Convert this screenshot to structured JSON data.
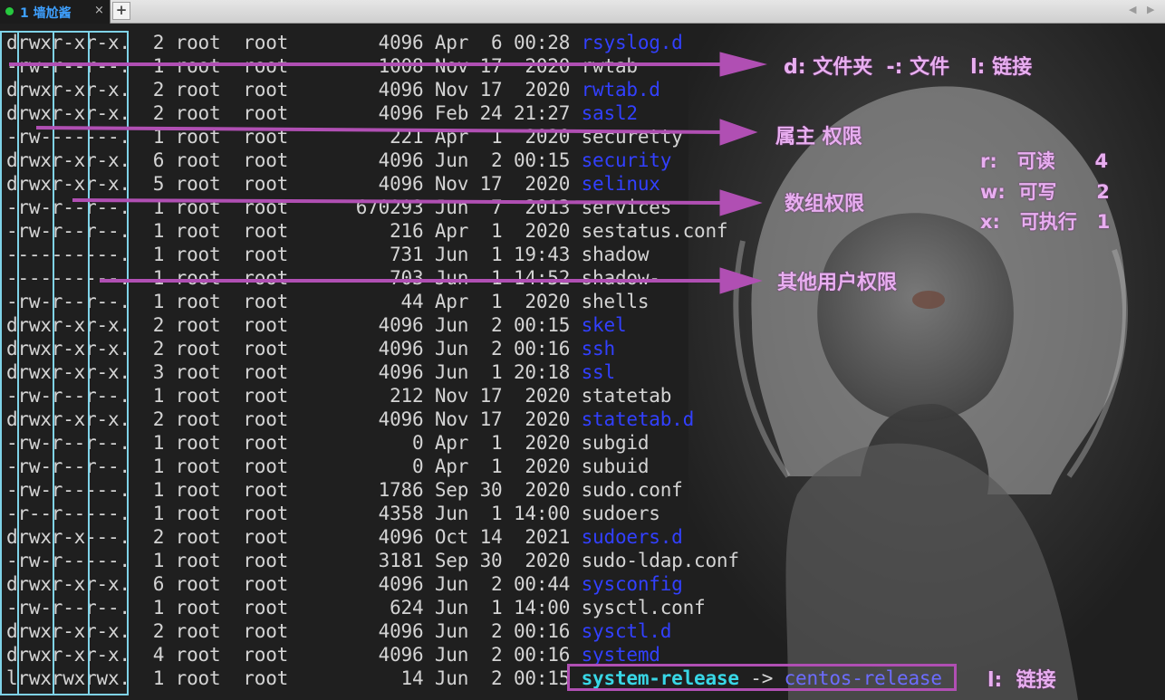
{
  "tabbar": {
    "tab_label": "1 墙尬酱",
    "close_glyph": "×",
    "add_glyph": "+",
    "nav_prev": "◀",
    "nav_next": "▶"
  },
  "listing": [
    {
      "perm": "drwxr-xr-x.",
      "links": "2",
      "owner": "root",
      "group": "root",
      "size": "4096",
      "month": "Apr",
      "day": "6",
      "time": "00:28",
      "name": "rsyslog.d",
      "kind": "dir"
    },
    {
      "perm": "-rw-r--r--.",
      "links": "1",
      "owner": "root",
      "group": "root",
      "size": "1008",
      "month": "Nov",
      "day": "17",
      "time": "2020",
      "name": "rwtab",
      "kind": "file"
    },
    {
      "perm": "drwxr-xr-x.",
      "links": "2",
      "owner": "root",
      "group": "root",
      "size": "4096",
      "month": "Nov",
      "day": "17",
      "time": "2020",
      "name": "rwtab.d",
      "kind": "dir"
    },
    {
      "perm": "drwxr-xr-x.",
      "links": "2",
      "owner": "root",
      "group": "root",
      "size": "4096",
      "month": "Feb",
      "day": "24",
      "time": "21:27",
      "name": "sasl2",
      "kind": "dir"
    },
    {
      "perm": "-rw-------.",
      "links": "1",
      "owner": "root",
      "group": "root",
      "size": "221",
      "month": "Apr",
      "day": "1",
      "time": "2020",
      "name": "securetty",
      "kind": "file"
    },
    {
      "perm": "drwxr-xr-x.",
      "links": "6",
      "owner": "root",
      "group": "root",
      "size": "4096",
      "month": "Jun",
      "day": "2",
      "time": "00:15",
      "name": "security",
      "kind": "dir"
    },
    {
      "perm": "drwxr-xr-x.",
      "links": "5",
      "owner": "root",
      "group": "root",
      "size": "4096",
      "month": "Nov",
      "day": "17",
      "time": "2020",
      "name": "selinux",
      "kind": "dir"
    },
    {
      "perm": "-rw-r--r--.",
      "links": "1",
      "owner": "root",
      "group": "root",
      "size": "670293",
      "month": "Jun",
      "day": "7",
      "time": "2013",
      "name": "services",
      "kind": "file"
    },
    {
      "perm": "-rw-r--r--.",
      "links": "1",
      "owner": "root",
      "group": "root",
      "size": "216",
      "month": "Apr",
      "day": "1",
      "time": "2020",
      "name": "sestatus.conf",
      "kind": "file"
    },
    {
      "perm": "----------.",
      "links": "1",
      "owner": "root",
      "group": "root",
      "size": "731",
      "month": "Jun",
      "day": "1",
      "time": "19:43",
      "name": "shadow",
      "kind": "file"
    },
    {
      "perm": "----------.",
      "links": "1",
      "owner": "root",
      "group": "root",
      "size": "703",
      "month": "Jun",
      "day": "1",
      "time": "14:52",
      "name": "shadow-",
      "kind": "file"
    },
    {
      "perm": "-rw-r--r--.",
      "links": "1",
      "owner": "root",
      "group": "root",
      "size": "44",
      "month": "Apr",
      "day": "1",
      "time": "2020",
      "name": "shells",
      "kind": "file"
    },
    {
      "perm": "drwxr-xr-x.",
      "links": "2",
      "owner": "root",
      "group": "root",
      "size": "4096",
      "month": "Jun",
      "day": "2",
      "time": "00:15",
      "name": "skel",
      "kind": "dir"
    },
    {
      "perm": "drwxr-xr-x.",
      "links": "2",
      "owner": "root",
      "group": "root",
      "size": "4096",
      "month": "Jun",
      "day": "2",
      "time": "00:16",
      "name": "ssh",
      "kind": "dir"
    },
    {
      "perm": "drwxr-xr-x.",
      "links": "3",
      "owner": "root",
      "group": "root",
      "size": "4096",
      "month": "Jun",
      "day": "1",
      "time": "20:18",
      "name": "ssl",
      "kind": "dir"
    },
    {
      "perm": "-rw-r--r--.",
      "links": "1",
      "owner": "root",
      "group": "root",
      "size": "212",
      "month": "Nov",
      "day": "17",
      "time": "2020",
      "name": "statetab",
      "kind": "file"
    },
    {
      "perm": "drwxr-xr-x.",
      "links": "2",
      "owner": "root",
      "group": "root",
      "size": "4096",
      "month": "Nov",
      "day": "17",
      "time": "2020",
      "name": "statetab.d",
      "kind": "dir"
    },
    {
      "perm": "-rw-r--r--.",
      "links": "1",
      "owner": "root",
      "group": "root",
      "size": "0",
      "month": "Apr",
      "day": "1",
      "time": "2020",
      "name": "subgid",
      "kind": "file"
    },
    {
      "perm": "-rw-r--r--.",
      "links": "1",
      "owner": "root",
      "group": "root",
      "size": "0",
      "month": "Apr",
      "day": "1",
      "time": "2020",
      "name": "subuid",
      "kind": "file"
    },
    {
      "perm": "-rw-r-----.",
      "links": "1",
      "owner": "root",
      "group": "root",
      "size": "1786",
      "month": "Sep",
      "day": "30",
      "time": "2020",
      "name": "sudo.conf",
      "kind": "file"
    },
    {
      "perm": "-r--r-----.",
      "links": "1",
      "owner": "root",
      "group": "root",
      "size": "4358",
      "month": "Jun",
      "day": "1",
      "time": "14:00",
      "name": "sudoers",
      "kind": "file"
    },
    {
      "perm": "drwxr-x---.",
      "links": "2",
      "owner": "root",
      "group": "root",
      "size": "4096",
      "month": "Oct",
      "day": "14",
      "time": "2021",
      "name": "sudoers.d",
      "kind": "dir"
    },
    {
      "perm": "-rw-r-----.",
      "links": "1",
      "owner": "root",
      "group": "root",
      "size": "3181",
      "month": "Sep",
      "day": "30",
      "time": "2020",
      "name": "sudo-ldap.conf",
      "kind": "file"
    },
    {
      "perm": "drwxr-xr-x.",
      "links": "6",
      "owner": "root",
      "group": "root",
      "size": "4096",
      "month": "Jun",
      "day": "2",
      "time": "00:44",
      "name": "sysconfig",
      "kind": "dir"
    },
    {
      "perm": "-rw-r--r--.",
      "links": "1",
      "owner": "root",
      "group": "root",
      "size": "624",
      "month": "Jun",
      "day": "1",
      "time": "14:00",
      "name": "sysctl.conf",
      "kind": "file"
    },
    {
      "perm": "drwxr-xr-x.",
      "links": "2",
      "owner": "root",
      "group": "root",
      "size": "4096",
      "month": "Jun",
      "day": "2",
      "time": "00:16",
      "name": "sysctl.d",
      "kind": "dir"
    },
    {
      "perm": "drwxr-xr-x.",
      "links": "4",
      "owner": "root",
      "group": "root",
      "size": "4096",
      "month": "Jun",
      "day": "2",
      "time": "00:16",
      "name": "systemd",
      "kind": "dir"
    },
    {
      "perm": "lrwxrwxrwx.",
      "links": "1",
      "owner": "root",
      "group": "root",
      "size": "14",
      "month": "Jun",
      "day": "2",
      "time": "00:15",
      "name": "system-release",
      "kind": "link",
      "arrow": "->",
      "target": "centos-release"
    }
  ],
  "annotations": {
    "type_note": "d: 文件夹  -: 文件   l: 链接",
    "owner_note": "属主 权限",
    "group_note": "数组权限",
    "other_note": "其他用户权限",
    "perm_r": "r:   可读      4",
    "perm_w": "w:  可写      2",
    "perm_x": "x:   可执行   1",
    "link_note": "l:  链接"
  },
  "colors": {
    "dir": "#3240ff",
    "link": "#38d7e6",
    "annotation_arrow": "#b04fb3",
    "column_box": "#7fd3e8"
  }
}
